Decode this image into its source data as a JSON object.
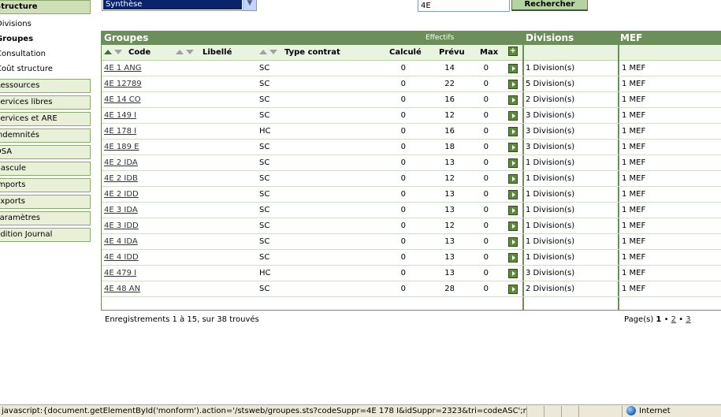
{
  "menu": {
    "structure": "Structure",
    "submenu": [
      {
        "label": "Divisions",
        "active": false
      },
      {
        "label": "Groupes",
        "active": true
      },
      {
        "label": "Consultation",
        "active": false
      },
      {
        "label": "Coût structure",
        "active": false
      }
    ],
    "sections": [
      "Ressources",
      "Services libres",
      "Services et ARE",
      "Indemnités",
      "DSA",
      "Bascule",
      "Imports",
      "Exports",
      "Paramètres",
      "Édition Journal"
    ]
  },
  "toolbar": {
    "view_select": "Synthèse",
    "search_value": "4E",
    "search_button": "Rechercher"
  },
  "table": {
    "title_groupes": "Groupes",
    "title_effectifs": "Effectifs",
    "title_divisions": "Divisions",
    "title_mef": "MEF",
    "col_code": "Code",
    "col_libelle": "Libellé",
    "col_type": "Type contrat",
    "col_calcule": "Calculé",
    "col_prevu": "Prévu",
    "col_max": "Max",
    "rows": [
      {
        "code": "4E 1 ANG",
        "type": "SC",
        "calcule": "0",
        "prevu": "14",
        "max": "0",
        "divisions": "1 Division(s)",
        "mef": "1 MEF"
      },
      {
        "code": "4E 12789",
        "type": "SC",
        "calcule": "0",
        "prevu": "22",
        "max": "0",
        "divisions": "5 Division(s)",
        "mef": "1 MEF"
      },
      {
        "code": "4E 14 CO",
        "type": "SC",
        "calcule": "0",
        "prevu": "16",
        "max": "0",
        "divisions": "2 Division(s)",
        "mef": "1 MEF"
      },
      {
        "code": "4E 149 I",
        "type": "SC",
        "calcule": "0",
        "prevu": "12",
        "max": "0",
        "divisions": "3 Division(s)",
        "mef": "1 MEF"
      },
      {
        "code": "4E 178 I",
        "type": "HC",
        "calcule": "0",
        "prevu": "16",
        "max": "0",
        "divisions": "3 Division(s)",
        "mef": "1 MEF"
      },
      {
        "code": "4E 189 E",
        "type": "SC",
        "calcule": "0",
        "prevu": "18",
        "max": "0",
        "divisions": "3 Division(s)",
        "mef": "1 MEF"
      },
      {
        "code": "4E 2 IDA",
        "type": "SC",
        "calcule": "0",
        "prevu": "13",
        "max": "0",
        "divisions": "1 Division(s)",
        "mef": "1 MEF"
      },
      {
        "code": "4E 2 IDB",
        "type": "SC",
        "calcule": "0",
        "prevu": "12",
        "max": "0",
        "divisions": "1 Division(s)",
        "mef": "1 MEF"
      },
      {
        "code": "4E 2 IDD",
        "type": "SC",
        "calcule": "0",
        "prevu": "13",
        "max": "0",
        "divisions": "1 Division(s)",
        "mef": "1 MEF"
      },
      {
        "code": "4E 3 IDA",
        "type": "SC",
        "calcule": "0",
        "prevu": "13",
        "max": "0",
        "divisions": "1 Division(s)",
        "mef": "1 MEF"
      },
      {
        "code": "4E 3 IDD",
        "type": "SC",
        "calcule": "0",
        "prevu": "12",
        "max": "0",
        "divisions": "1 Division(s)",
        "mef": "1 MEF"
      },
      {
        "code": "4E 4 IDA",
        "type": "SC",
        "calcule": "0",
        "prevu": "13",
        "max": "0",
        "divisions": "1 Division(s)",
        "mef": "1 MEF"
      },
      {
        "code": "4E 4 IDD",
        "type": "SC",
        "calcule": "0",
        "prevu": "13",
        "max": "0",
        "divisions": "1 Division(s)",
        "mef": "1 MEF"
      },
      {
        "code": "4E 479 I",
        "type": "HC",
        "calcule": "0",
        "prevu": "13",
        "max": "0",
        "divisions": "3 Division(s)",
        "mef": "1 MEF"
      },
      {
        "code": "4E 48 AN",
        "type": "SC",
        "calcule": "0",
        "prevu": "28",
        "max": "0",
        "divisions": "2 Division(s)",
        "mef": "1 MEF"
      }
    ]
  },
  "footer": {
    "count": "Enregistrements 1 à 15, sur 38 trouvés",
    "pages_label": "Page(s)",
    "pages": [
      "1",
      "2",
      "3"
    ],
    "current_page": "1"
  },
  "status": {
    "text": "javascript:{document.getElementById('monform').action='/stsweb/groupes.sts?codeSuppr=4E 178 I&idSuppr=2323&tri=codeASC';majAkti",
    "zone": "Internet"
  },
  "colors": {
    "header_green": "#6b8e5a",
    "menu_bg": "#e8f0d8",
    "selection_blue": "#0a246a"
  }
}
